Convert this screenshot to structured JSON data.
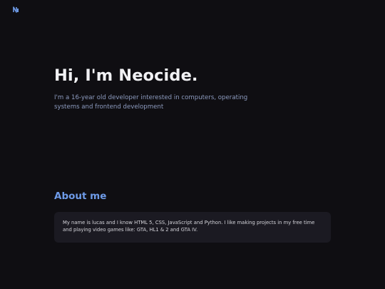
{
  "header": {
    "logo_icon": "neocide-logo-icon",
    "logo_color": "#6e9be8"
  },
  "hero": {
    "title": "Hi, I'm Neocide.",
    "subtitle": "I'm a 16-year old developer interested in computers, operating systems and frontend development"
  },
  "about": {
    "heading": "About me",
    "text": "My name is lucas and I know HTML 5, CSS, JavaScript and Python. I like making projects in my free time and playing video games like: GTA, HL1 & 2 and GTA IV."
  },
  "colors": {
    "background": "#0f0e12",
    "accent": "#6e9be8",
    "card": "#1b1a22"
  }
}
